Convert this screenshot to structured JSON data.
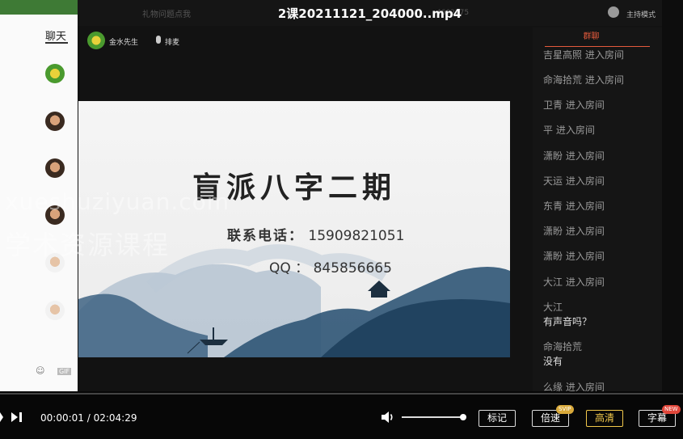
{
  "left_app": {
    "chat_tab": "聊天",
    "tools_text": "GIF"
  },
  "video": {
    "title": "2课20211121_204000..mp4",
    "bg_title_text": "礼物问题点我",
    "bg_room_id": "4602275",
    "mode_label": "主持模式",
    "host_name": "金水先生",
    "mic_label": "排麦"
  },
  "slide": {
    "title": "盲派八字二期",
    "phone_label": "联系电话：",
    "phone_value": "15909821051",
    "qq_label": "QQ ：",
    "qq_value": "845856665"
  },
  "panel": {
    "tab": "群聊",
    "messages": [
      {
        "text": "吉星高照 进入房间",
        "style": "join"
      },
      {
        "text": "命海拾荒 进入房间",
        "style": "join"
      },
      {
        "text": "卫青 进入房间",
        "style": "join"
      },
      {
        "text": "平 进入房间",
        "style": "join"
      },
      {
        "text": "潇盼 进入房间",
        "style": "join"
      },
      {
        "text": "天运 进入房间",
        "style": "join"
      },
      {
        "text": "东青 进入房间",
        "style": "join"
      },
      {
        "text": "潇盼 进入房间",
        "style": "join"
      },
      {
        "text": "潇盼 进入房间",
        "style": "join"
      },
      {
        "text": "大江 进入房间",
        "style": "join"
      },
      {
        "text": "大江",
        "style": "join"
      },
      {
        "text": "有声音吗？",
        "style": "chat"
      },
      {
        "text": "命海拾荒",
        "style": "join"
      },
      {
        "text": "没有",
        "style": "chat"
      },
      {
        "text": "么缘 进入房间",
        "style": "join"
      }
    ]
  },
  "watermark": {
    "line1": "xueshuziyuan.com",
    "line2": "学术资源课程"
  },
  "controls": {
    "current_time": "00:00:01",
    "separator": " / ",
    "total_time": "02:04:29",
    "volume_level": 1.0,
    "mark_button": "标记",
    "speed_button": "倍速",
    "speed_badge": "SVIP",
    "quality_button": "高清",
    "subtitle_button": "字幕",
    "subtitle_badge": "NEW",
    "accent_color": "#f2c84b"
  }
}
